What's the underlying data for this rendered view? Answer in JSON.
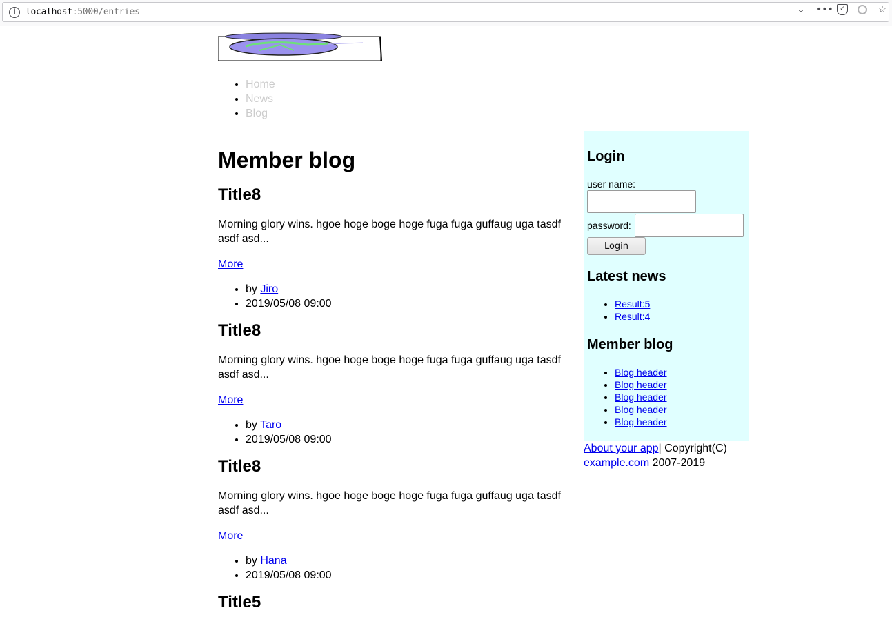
{
  "browser": {
    "url_host": "localhost",
    "url_path": ":5000/entries"
  },
  "nav": {
    "items": [
      {
        "label": "Home"
      },
      {
        "label": "News"
      },
      {
        "label": "Blog"
      }
    ]
  },
  "main": {
    "title": "Member blog",
    "entries": [
      {
        "title": "Title8",
        "excerpt": "Morning glory wins. hgoe hoge boge hoge fuga fuga guffaug uga tasdf asdf asd...",
        "more": "More",
        "by": "by ",
        "author": "Jiro",
        "date": "2019/05/08 09:00"
      },
      {
        "title": "Title8",
        "excerpt": "Morning glory wins. hgoe hoge boge hoge fuga fuga guffaug uga tasdf asdf asd...",
        "more": "More",
        "by": "by ",
        "author": "Taro",
        "date": "2019/05/08 09:00"
      },
      {
        "title": "Title8",
        "excerpt": "Morning glory wins. hgoe hoge boge hoge fuga fuga guffaug uga tasdf asdf asd...",
        "more": "More",
        "by": "by ",
        "author": "Hana",
        "date": "2019/05/08 09:00"
      },
      {
        "title": "Title5"
      }
    ]
  },
  "sidebar": {
    "login": {
      "title": "Login",
      "username_label": "user name:",
      "username_value": "",
      "password_label": "password:",
      "password_value": "",
      "button": "Login"
    },
    "news": {
      "title": "Latest news",
      "items": [
        "Result:5",
        "Result:4"
      ]
    },
    "blog": {
      "title": "Member blog",
      "items": [
        "Blog header",
        "Blog header",
        "Blog header",
        "Blog header",
        "Blog header"
      ]
    }
  },
  "footer": {
    "about_link": "About your app",
    "copyright": "| Copyright(C)",
    "site_link": "example.com",
    "years": " 2007-2019"
  },
  "colors": {
    "sidebar_bg": "#e0ffff",
    "link": "#0000ee",
    "nav_link": "#cccccc"
  }
}
